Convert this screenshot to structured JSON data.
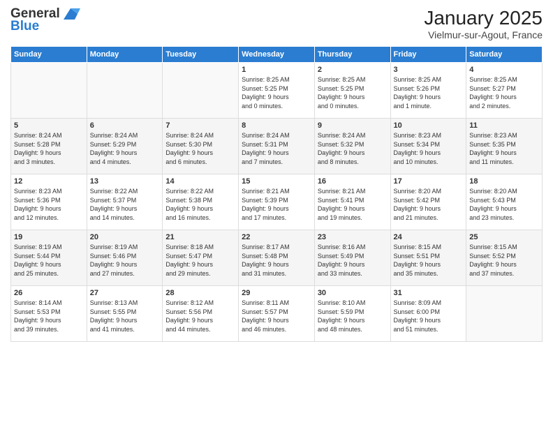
{
  "header": {
    "logo_line1": "General",
    "logo_line2": "Blue",
    "month_title": "January 2025",
    "location": "Vielmur-sur-Agout, France"
  },
  "days_of_week": [
    "Sunday",
    "Monday",
    "Tuesday",
    "Wednesday",
    "Thursday",
    "Friday",
    "Saturday"
  ],
  "weeks": [
    [
      {
        "day": "",
        "info": ""
      },
      {
        "day": "",
        "info": ""
      },
      {
        "day": "",
        "info": ""
      },
      {
        "day": "1",
        "info": "Sunrise: 8:25 AM\nSunset: 5:25 PM\nDaylight: 9 hours\nand 0 minutes."
      },
      {
        "day": "2",
        "info": "Sunrise: 8:25 AM\nSunset: 5:25 PM\nDaylight: 9 hours\nand 0 minutes."
      },
      {
        "day": "3",
        "info": "Sunrise: 8:25 AM\nSunset: 5:26 PM\nDaylight: 9 hours\nand 1 minute."
      },
      {
        "day": "4",
        "info": "Sunrise: 8:25 AM\nSunset: 5:27 PM\nDaylight: 9 hours\nand 2 minutes."
      }
    ],
    [
      {
        "day": "5",
        "info": "Sunrise: 8:24 AM\nSunset: 5:28 PM\nDaylight: 9 hours\nand 3 minutes."
      },
      {
        "day": "6",
        "info": "Sunrise: 8:24 AM\nSunset: 5:29 PM\nDaylight: 9 hours\nand 4 minutes."
      },
      {
        "day": "7",
        "info": "Sunrise: 8:24 AM\nSunset: 5:30 PM\nDaylight: 9 hours\nand 6 minutes."
      },
      {
        "day": "8",
        "info": "Sunrise: 8:24 AM\nSunset: 5:31 PM\nDaylight: 9 hours\nand 7 minutes."
      },
      {
        "day": "9",
        "info": "Sunrise: 8:24 AM\nSunset: 5:32 PM\nDaylight: 9 hours\nand 8 minutes."
      },
      {
        "day": "10",
        "info": "Sunrise: 8:23 AM\nSunset: 5:34 PM\nDaylight: 9 hours\nand 10 minutes."
      },
      {
        "day": "11",
        "info": "Sunrise: 8:23 AM\nSunset: 5:35 PM\nDaylight: 9 hours\nand 11 minutes."
      }
    ],
    [
      {
        "day": "12",
        "info": "Sunrise: 8:23 AM\nSunset: 5:36 PM\nDaylight: 9 hours\nand 12 minutes."
      },
      {
        "day": "13",
        "info": "Sunrise: 8:22 AM\nSunset: 5:37 PM\nDaylight: 9 hours\nand 14 minutes."
      },
      {
        "day": "14",
        "info": "Sunrise: 8:22 AM\nSunset: 5:38 PM\nDaylight: 9 hours\nand 16 minutes."
      },
      {
        "day": "15",
        "info": "Sunrise: 8:21 AM\nSunset: 5:39 PM\nDaylight: 9 hours\nand 17 minutes."
      },
      {
        "day": "16",
        "info": "Sunrise: 8:21 AM\nSunset: 5:41 PM\nDaylight: 9 hours\nand 19 minutes."
      },
      {
        "day": "17",
        "info": "Sunrise: 8:20 AM\nSunset: 5:42 PM\nDaylight: 9 hours\nand 21 minutes."
      },
      {
        "day": "18",
        "info": "Sunrise: 8:20 AM\nSunset: 5:43 PM\nDaylight: 9 hours\nand 23 minutes."
      }
    ],
    [
      {
        "day": "19",
        "info": "Sunrise: 8:19 AM\nSunset: 5:44 PM\nDaylight: 9 hours\nand 25 minutes."
      },
      {
        "day": "20",
        "info": "Sunrise: 8:19 AM\nSunset: 5:46 PM\nDaylight: 9 hours\nand 27 minutes."
      },
      {
        "day": "21",
        "info": "Sunrise: 8:18 AM\nSunset: 5:47 PM\nDaylight: 9 hours\nand 29 minutes."
      },
      {
        "day": "22",
        "info": "Sunrise: 8:17 AM\nSunset: 5:48 PM\nDaylight: 9 hours\nand 31 minutes."
      },
      {
        "day": "23",
        "info": "Sunrise: 8:16 AM\nSunset: 5:49 PM\nDaylight: 9 hours\nand 33 minutes."
      },
      {
        "day": "24",
        "info": "Sunrise: 8:15 AM\nSunset: 5:51 PM\nDaylight: 9 hours\nand 35 minutes."
      },
      {
        "day": "25",
        "info": "Sunrise: 8:15 AM\nSunset: 5:52 PM\nDaylight: 9 hours\nand 37 minutes."
      }
    ],
    [
      {
        "day": "26",
        "info": "Sunrise: 8:14 AM\nSunset: 5:53 PM\nDaylight: 9 hours\nand 39 minutes."
      },
      {
        "day": "27",
        "info": "Sunrise: 8:13 AM\nSunset: 5:55 PM\nDaylight: 9 hours\nand 41 minutes."
      },
      {
        "day": "28",
        "info": "Sunrise: 8:12 AM\nSunset: 5:56 PM\nDaylight: 9 hours\nand 44 minutes."
      },
      {
        "day": "29",
        "info": "Sunrise: 8:11 AM\nSunset: 5:57 PM\nDaylight: 9 hours\nand 46 minutes."
      },
      {
        "day": "30",
        "info": "Sunrise: 8:10 AM\nSunset: 5:59 PM\nDaylight: 9 hours\nand 48 minutes."
      },
      {
        "day": "31",
        "info": "Sunrise: 8:09 AM\nSunset: 6:00 PM\nDaylight: 9 hours\nand 51 minutes."
      },
      {
        "day": "",
        "info": ""
      }
    ]
  ]
}
